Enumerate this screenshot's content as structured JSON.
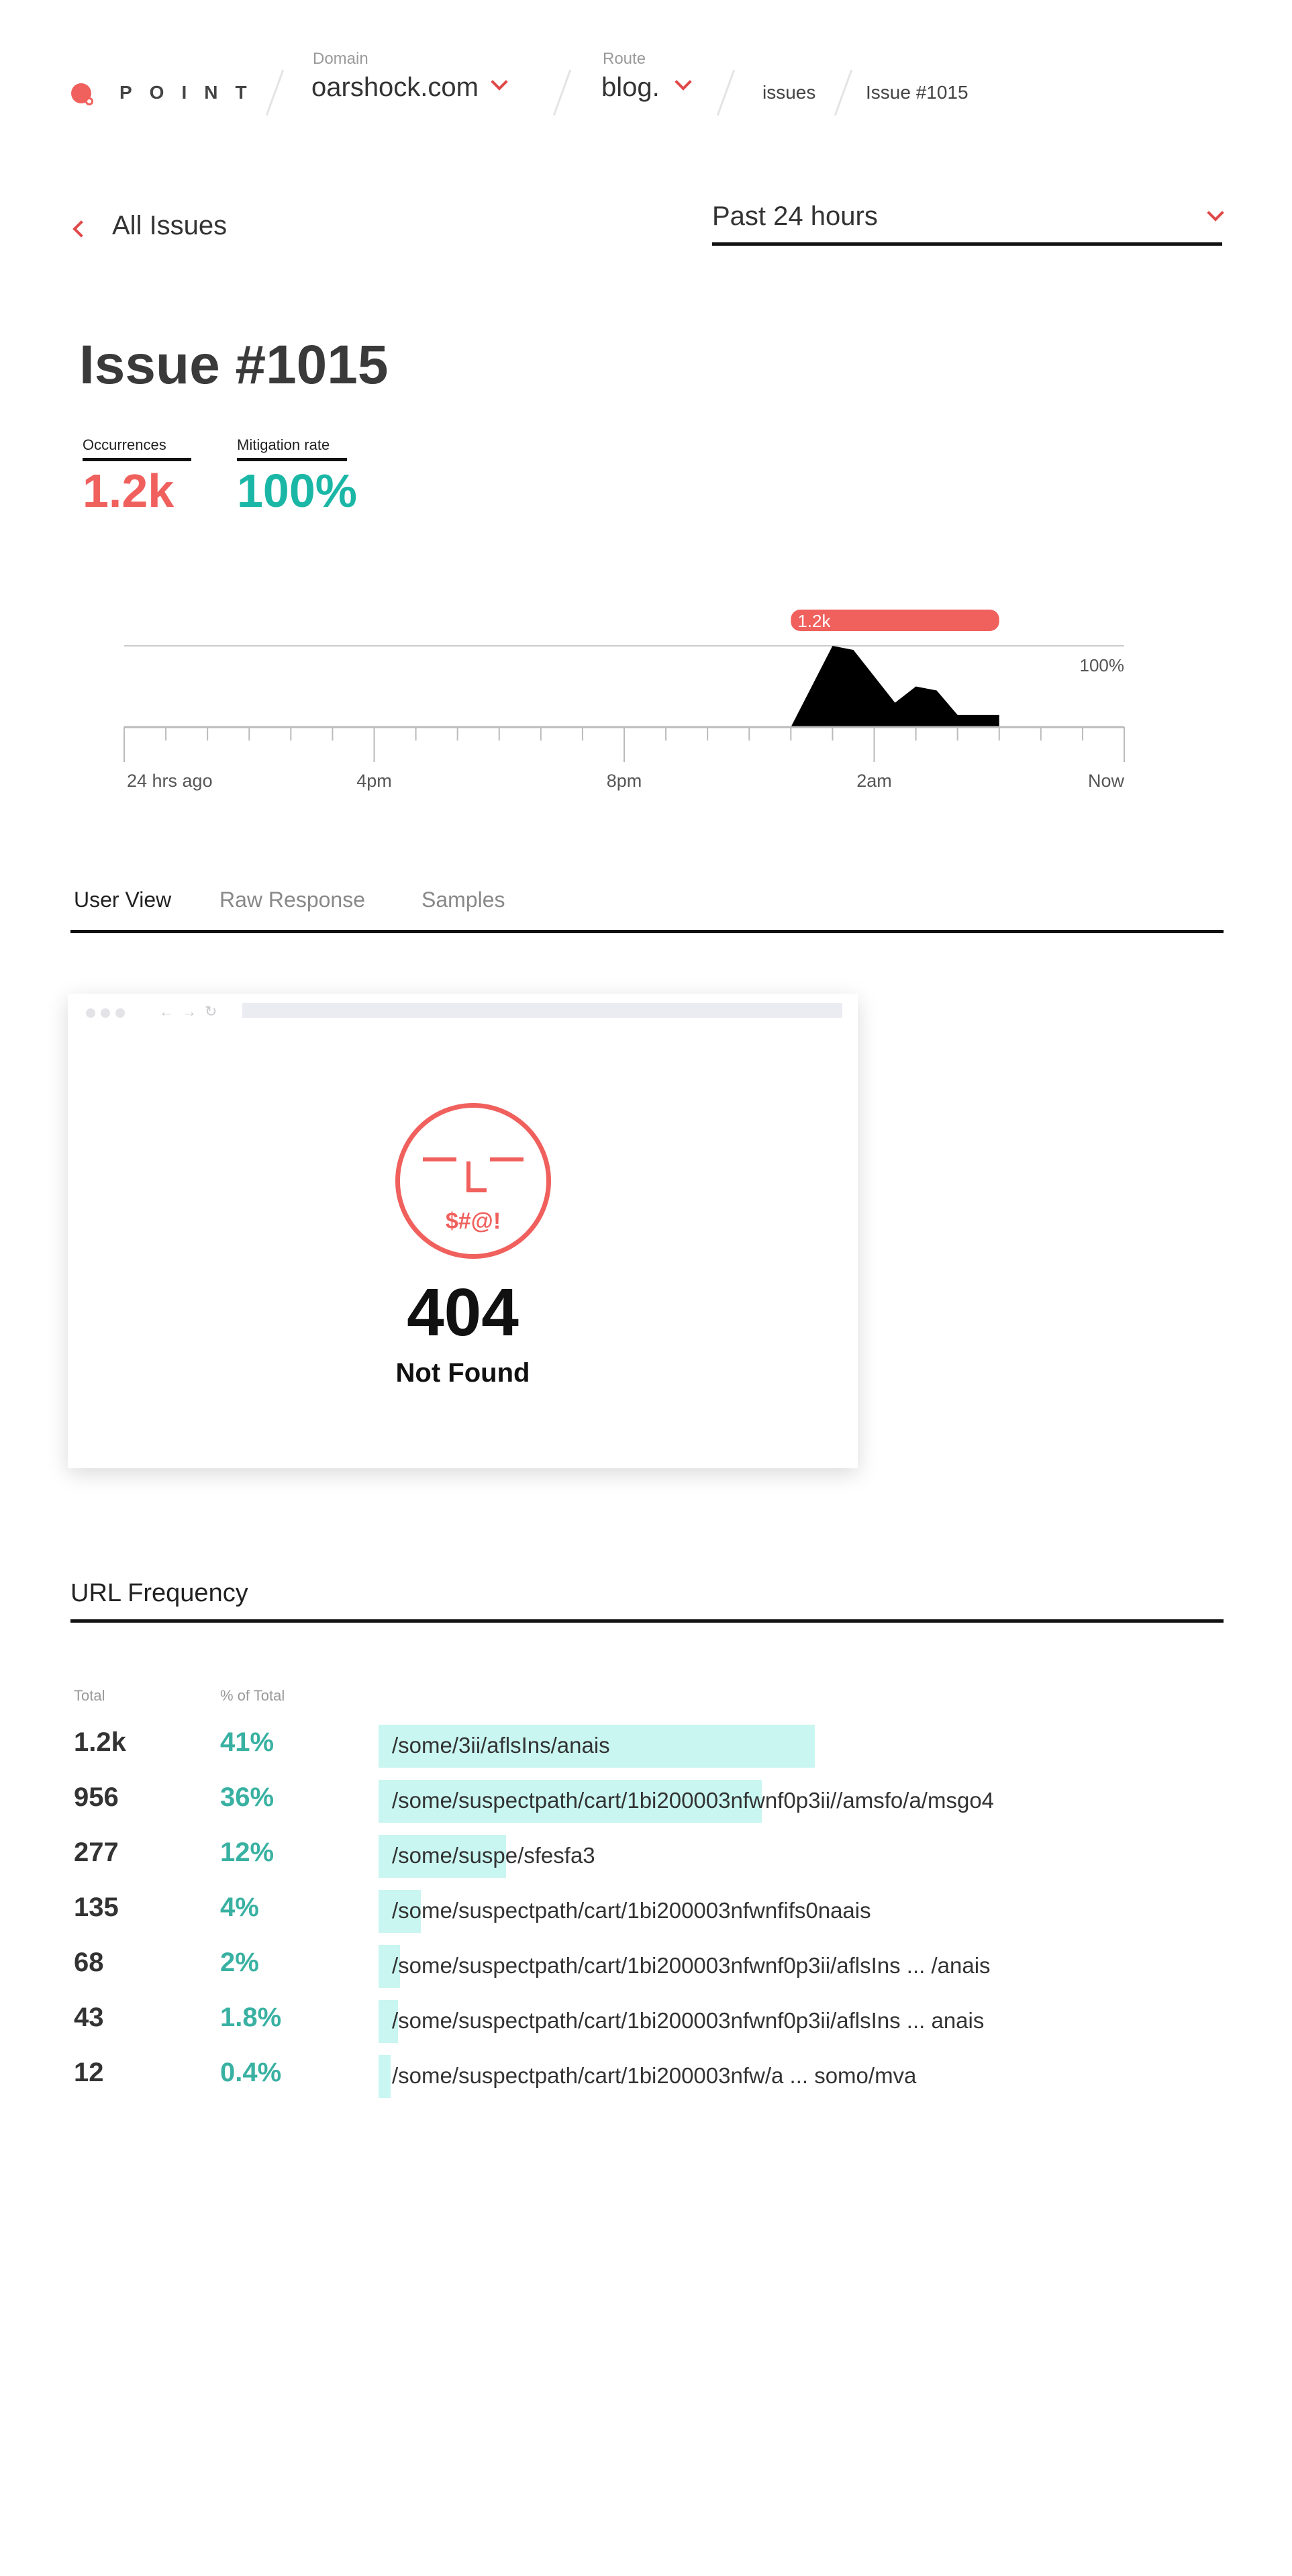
{
  "header": {
    "logo_text": "POINT",
    "domain_label": "Domain",
    "domain_value": "oarshock.com",
    "route_label": "Route",
    "route_value": "blog.",
    "crumb_issues": "issues",
    "crumb_issue": "Issue #1015"
  },
  "nav": {
    "back_label": "All Issues",
    "time_range": "Past 24 hours"
  },
  "issue": {
    "title": "Issue #1015",
    "occurrences_label": "Occurrences",
    "occurrences_value": "1.2k",
    "mitigation_label": "Mitigation rate",
    "mitigation_value": "100%"
  },
  "colors": {
    "accent_red": "#f0605d",
    "accent_teal": "#1bb7a6",
    "bar_teal": "#c9f6f1"
  },
  "chart_data": {
    "type": "area",
    "peak_label": "1.2k",
    "max_label": "100%",
    "x_tick_labels": [
      "24 hrs ago",
      "4pm",
      "8pm",
      "2am",
      "Now"
    ],
    "series": [
      {
        "x_hours": [
          16,
          17,
          17.5,
          18.5,
          19,
          19.5,
          20,
          21
        ],
        "values": [
          0,
          1.0,
          0.95,
          0.3,
          0.5,
          0.45,
          0.15,
          0.15
        ]
      }
    ]
  },
  "tabs": [
    {
      "label": "User View",
      "active": true
    },
    {
      "label": "Raw Response",
      "active": false
    },
    {
      "label": "Samples",
      "active": false
    }
  ],
  "preview": {
    "face_text": "$#@!",
    "code": "404",
    "message": "Not Found"
  },
  "url_frequency": {
    "title": "URL Frequency",
    "col_total": "Total",
    "col_pct": "% of Total",
    "rows": [
      {
        "total": "1.2k",
        "pct": "41%",
        "share": 0.41,
        "url": "/some/3ii/aflsIns/anais"
      },
      {
        "total": "956",
        "pct": "36%",
        "share": 0.36,
        "url": "/some/suspectpath/cart/1bi200003nfwnf0p3ii//amsfo/a/msgo4"
      },
      {
        "total": "277",
        "pct": "12%",
        "share": 0.12,
        "url": "/some/suspe/sfesfa3"
      },
      {
        "total": "135",
        "pct": "4%",
        "share": 0.04,
        "url": "/some/suspectpath/cart/1bi200003nfwnfifs0naais"
      },
      {
        "total": "68",
        "pct": "2%",
        "share": 0.02,
        "url": "/some/suspectpath/cart/1bi200003nfwnf0p3ii/aflsIns ... /anais"
      },
      {
        "total": "43",
        "pct": "1.8%",
        "share": 0.018,
        "url": "/some/suspectpath/cart/1bi200003nfwnf0p3ii/aflsIns ... anais"
      },
      {
        "total": "12",
        "pct": "0.4%",
        "share": 0.004,
        "url": "/some/suspectpath/cart/1bi200003nfw/a  ... somo/mva"
      }
    ]
  }
}
